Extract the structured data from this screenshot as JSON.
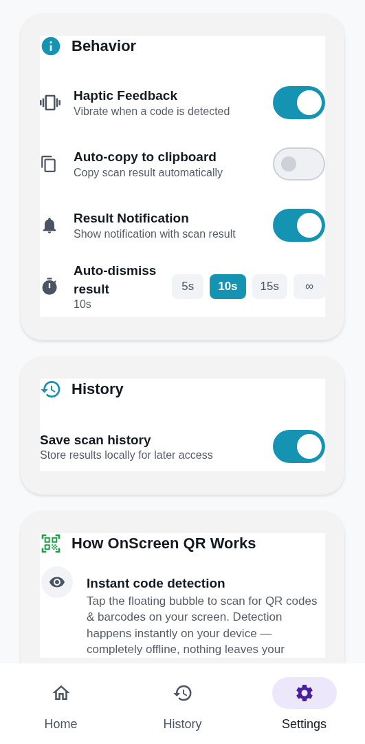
{
  "sections": [
    {
      "kind": "behavior",
      "title": "Behavior",
      "rows": [
        {
          "kind": "toggle",
          "title": "Haptic Feedback",
          "subtitle": "Vibrate when a code is detected",
          "on": true
        },
        {
          "kind": "toggle",
          "title": "Auto-copy to clipboard",
          "subtitle": "Copy scan result automatically",
          "on": false
        },
        {
          "kind": "toggle",
          "title": "Result Notification",
          "subtitle": "Show notification with scan result",
          "on": true
        },
        {
          "kind": "choice",
          "title": "Auto-dismiss result",
          "subtitle": "10s",
          "options": [
            {
              "label": "5s",
              "selected": false
            },
            {
              "label": "10s",
              "selected": true
            },
            {
              "label": "15s",
              "selected": false
            },
            {
              "label": "∞",
              "selected": false
            }
          ]
        }
      ]
    },
    {
      "kind": "history",
      "title": "History",
      "rows": [
        {
          "kind": "toggle",
          "title": "Save scan history",
          "subtitle": "Store results locally for later access",
          "on": true
        }
      ]
    },
    {
      "kind": "how",
      "title": "How OnScreen QR Works",
      "features": [
        {
          "title": "Instant code detection",
          "text": "Tap the floating bubble to scan for QR codes & barcodes on your screen. Detection happens instantly on your device — completely offline, nothing leaves your"
        }
      ]
    }
  ],
  "nav": [
    {
      "label": "Home",
      "selected": false
    },
    {
      "label": "History",
      "selected": false
    },
    {
      "label": "Settings",
      "selected": true
    }
  ]
}
